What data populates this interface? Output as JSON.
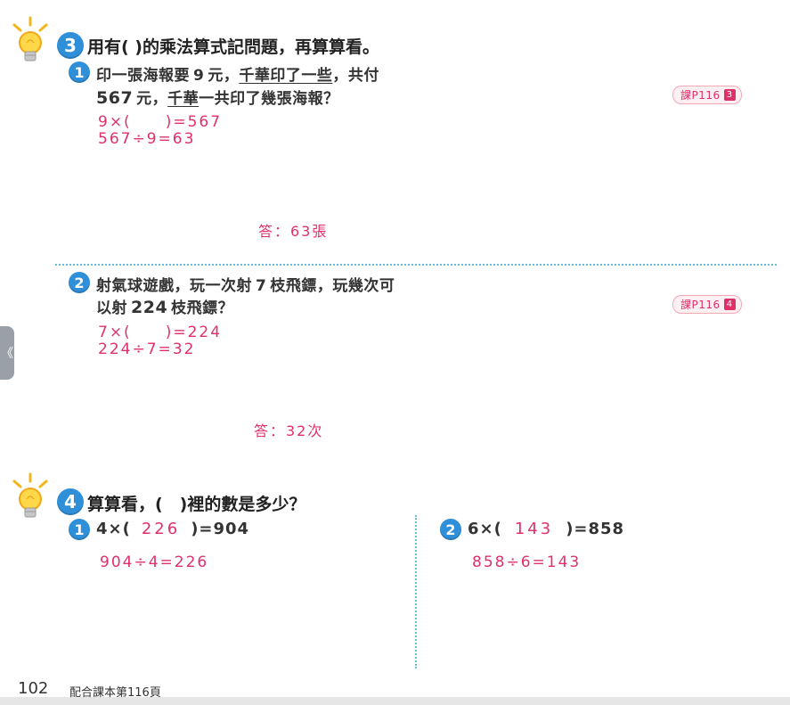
{
  "section3": {
    "badge": "3",
    "title": "用有( )的乘法算式記問題，再算算看。",
    "problems": [
      {
        "badge": "1",
        "line1_a": "印一張海報要",
        "line1_b": "9",
        "line1_c": "元，",
        "line1_d": "千華印了一些",
        "line1_e": "，共付",
        "line2_a": "567",
        "line2_b": "元，",
        "line2_c": "千華",
        "line2_d": "一共印了幾張海報？",
        "ref_label": "課P116",
        "ref_num": "3",
        "work1": "9×(　　)=567",
        "work2": "567÷9=63",
        "answer": "答：63張"
      },
      {
        "badge": "2",
        "line1_a": "射氣球遊戲，玩一次射",
        "line1_b": "7",
        "line1_c": "枝飛鏢，玩幾次可",
        "line2_a": "以射",
        "line2_b": "224",
        "line2_c": "枝飛鏢？",
        "ref_label": "課P116",
        "ref_num": "4",
        "work1": "7×(　　)=224",
        "work2": "224÷7=32",
        "answer": "答：32次"
      }
    ]
  },
  "section4": {
    "badge": "4",
    "title": "算算看，(　)裡的數是多少？",
    "items": [
      {
        "badge": "1",
        "left": "4×(",
        "value": "226",
        "right": ")=904",
        "work": "904÷4=226"
      },
      {
        "badge": "2",
        "left": "6×(",
        "value": "143",
        "right": ")=858",
        "work": "858÷6=143"
      }
    ]
  },
  "footer": {
    "page_number": "102",
    "text": "配合課本第116頁"
  },
  "side_tab": {
    "glyph": "《"
  },
  "colors": {
    "accent_blue": "#2f8fd8",
    "answer_pink": "#e0306a",
    "divider": "#66bfd8"
  }
}
